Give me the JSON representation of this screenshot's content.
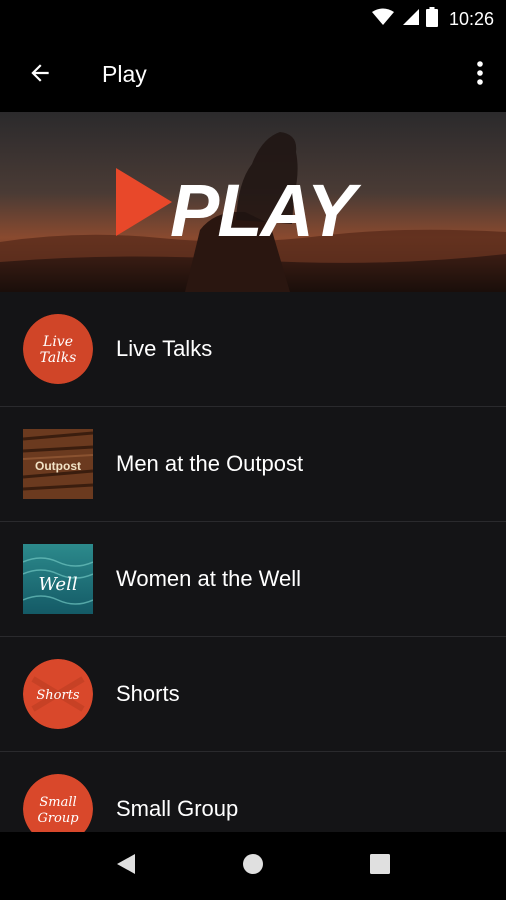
{
  "status_bar": {
    "time": "10:26",
    "icons": [
      "wifi-icon",
      "cell-signal-icon",
      "battery-icon"
    ]
  },
  "app_bar": {
    "title": "Play",
    "back_icon": "arrow-back-icon",
    "menu_icon": "more-vert-icon"
  },
  "banner": {
    "logo_text": "PLAY",
    "accent_color": "#e8482a"
  },
  "list": {
    "items": [
      {
        "label": "Live Talks",
        "thumb_text_1": "Live",
        "thumb_text_2": "Talks"
      },
      {
        "label": "Men at the Outpost",
        "thumb_text_1": "Outpost",
        "thumb_text_2": ""
      },
      {
        "label": "Women at the Well",
        "thumb_text_1": "Well",
        "thumb_text_2": ""
      },
      {
        "label": "Shorts",
        "thumb_text_1": "Shorts",
        "thumb_text_2": ""
      },
      {
        "label": "Small Group",
        "thumb_text_1": "Small",
        "thumb_text_2": "Group"
      }
    ]
  },
  "nav_bar": {
    "icons": [
      "nav-back-icon",
      "nav-home-icon",
      "nav-recents-icon"
    ]
  }
}
